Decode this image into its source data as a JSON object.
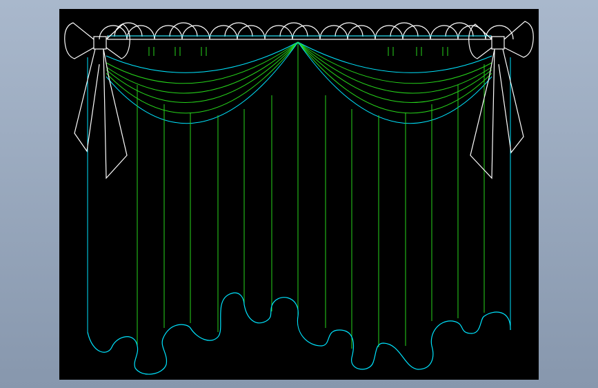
{
  "colors": {
    "background_outer": "#9aaabf",
    "viewport_background": "#000000",
    "outline_white": "#ffffff",
    "outline_cyan": "#00e5ff",
    "panel_green": "#27d61b"
  },
  "drawing": {
    "subject": "curtain-with-valance-and-bow-tiebacks",
    "elements": [
      "curtain-rod",
      "scalloped-valance",
      "swag-drapes",
      "pleated-panels",
      "bow-tiebacks"
    ]
  }
}
